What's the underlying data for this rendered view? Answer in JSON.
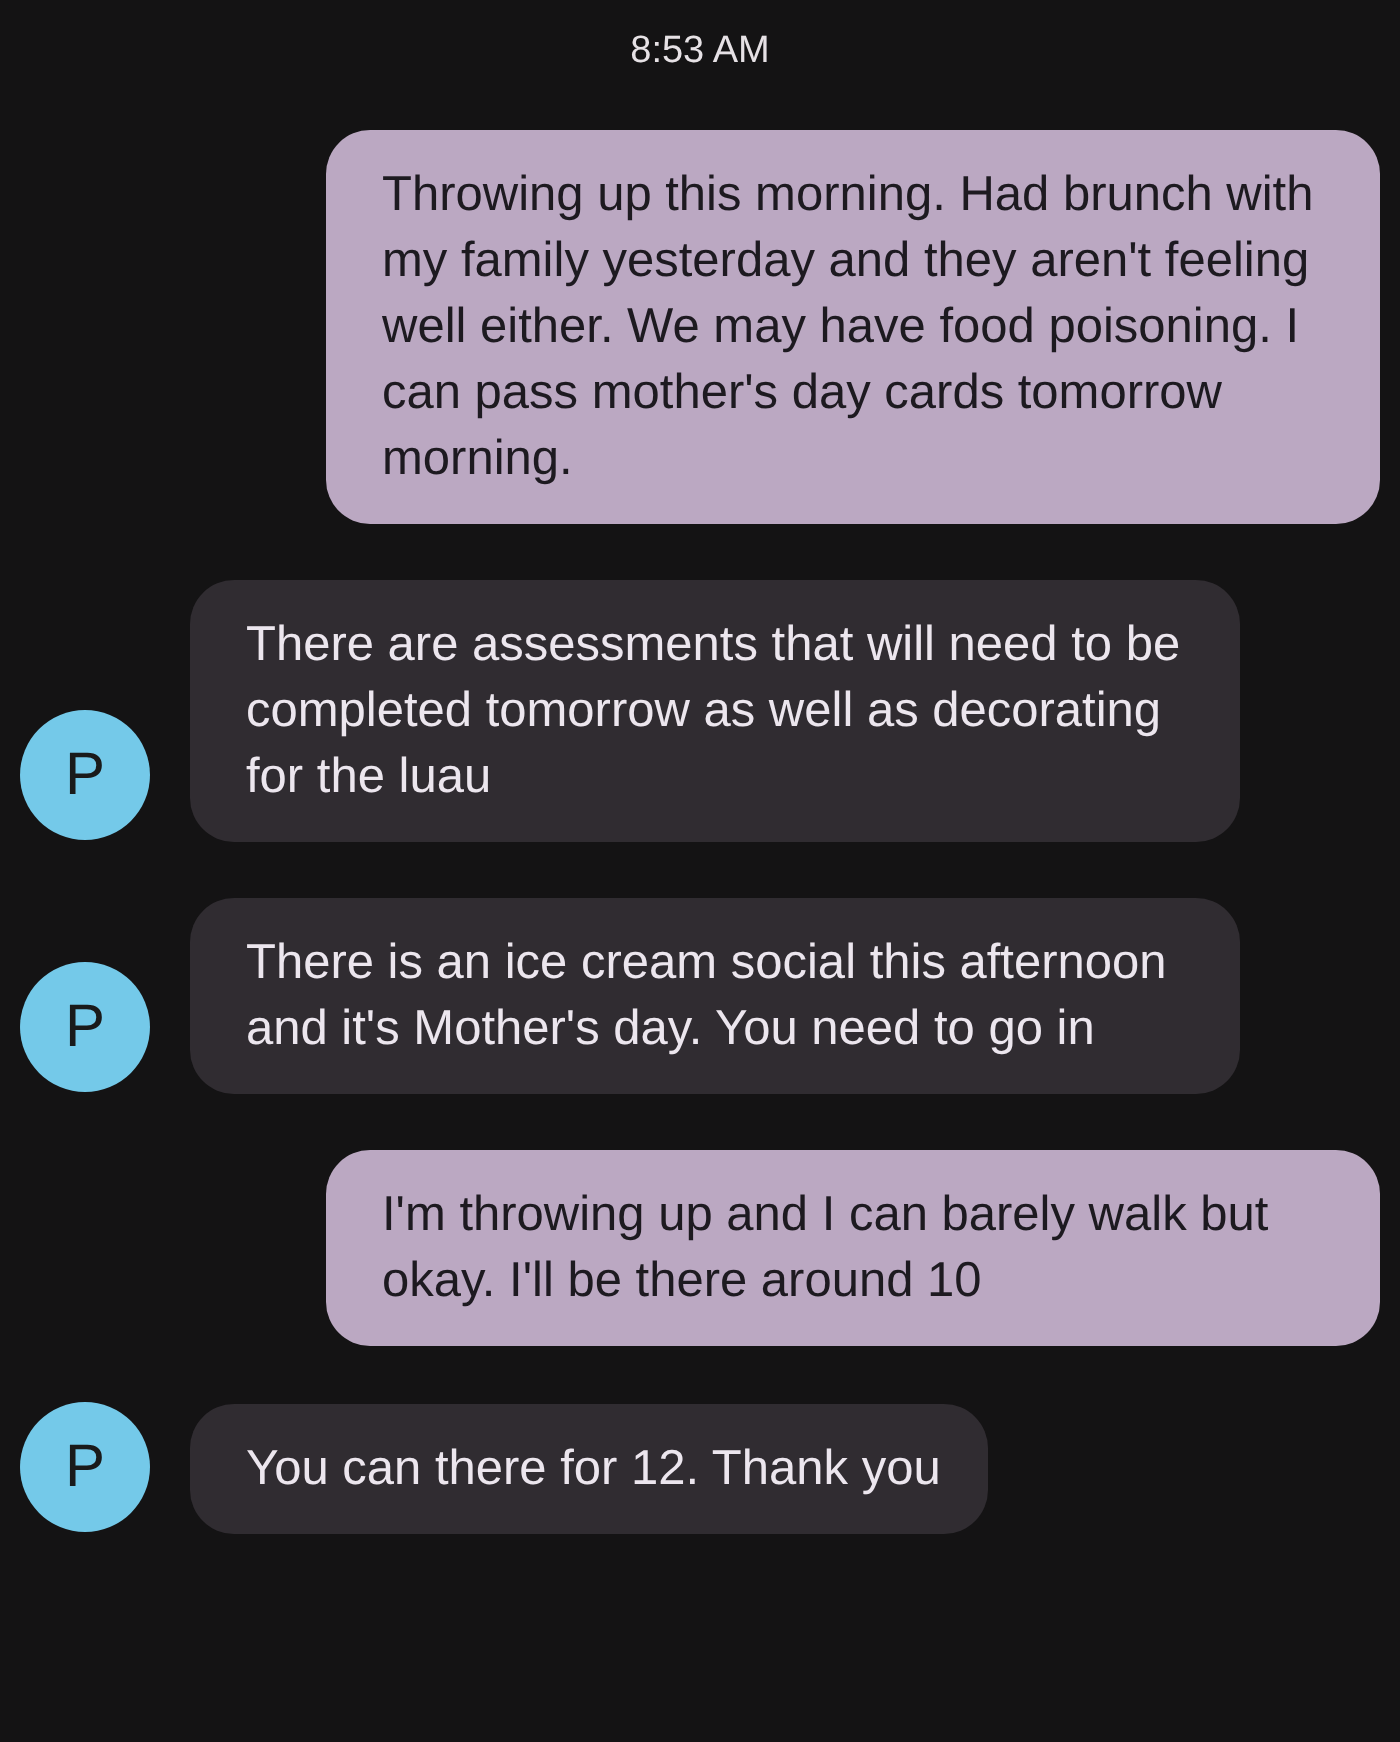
{
  "timestamp": "8:53 AM",
  "messages": [
    {
      "kind": "sent",
      "text": "Throwing up this morning. Had brunch with my family yesterday and they aren't feeling well either. We may have food poisoning. I can pass mother's day cards tomorrow morning."
    },
    {
      "kind": "received",
      "avatar": "P",
      "text": "There are assessments that will need to be completed tomorrow as well as decorating for the luau"
    },
    {
      "kind": "received",
      "avatar": "P",
      "text": "There is an ice cream social this afternoon and it's Mother's day. You need to go in"
    },
    {
      "kind": "sent",
      "text": "I'm throwing up and I can barely walk but okay. I'll be there around 10"
    },
    {
      "kind": "received",
      "avatar": "P",
      "text": "You can there for 12. Thank you"
    }
  ]
}
